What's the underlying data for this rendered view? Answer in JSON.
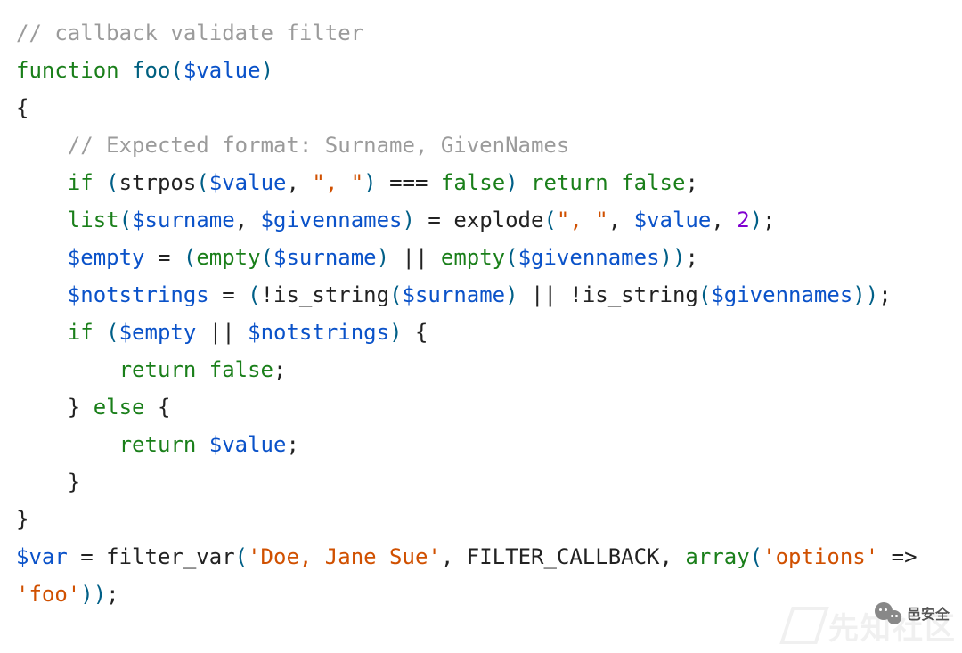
{
  "code": {
    "t00": "// callback validate filter",
    "t01": "function",
    "t02": "foo",
    "t03": "$value",
    "t04": "// Expected format: Surname, GivenNames",
    "t05": "if",
    "t06": "strpos",
    "t07": "\", \"",
    "t08": "===",
    "t09": "false",
    "t10": "return",
    "t11": "false",
    "t12": "list",
    "t13": "$surname",
    "t14": "$givennames",
    "t15": "explode",
    "t16": "\", \"",
    "t17": "2",
    "t18": "$empty",
    "t19": "empty",
    "t20": "||",
    "t21": "empty",
    "t22": "$notstrings",
    "t23": "is_string",
    "t24": "is_string",
    "t25": "if",
    "t26": "return",
    "t27": "false",
    "t28": "else",
    "t29": "return",
    "t30": "$var",
    "t31": "filter_var",
    "t32": "'Doe, Jane Sue'",
    "t33": "FILTER_CALLBACK",
    "t34": "array",
    "t35": "'options'",
    "t36": "'foo'",
    "t37": "=>"
  },
  "watermark": "先知社区",
  "badge": "邑安全"
}
